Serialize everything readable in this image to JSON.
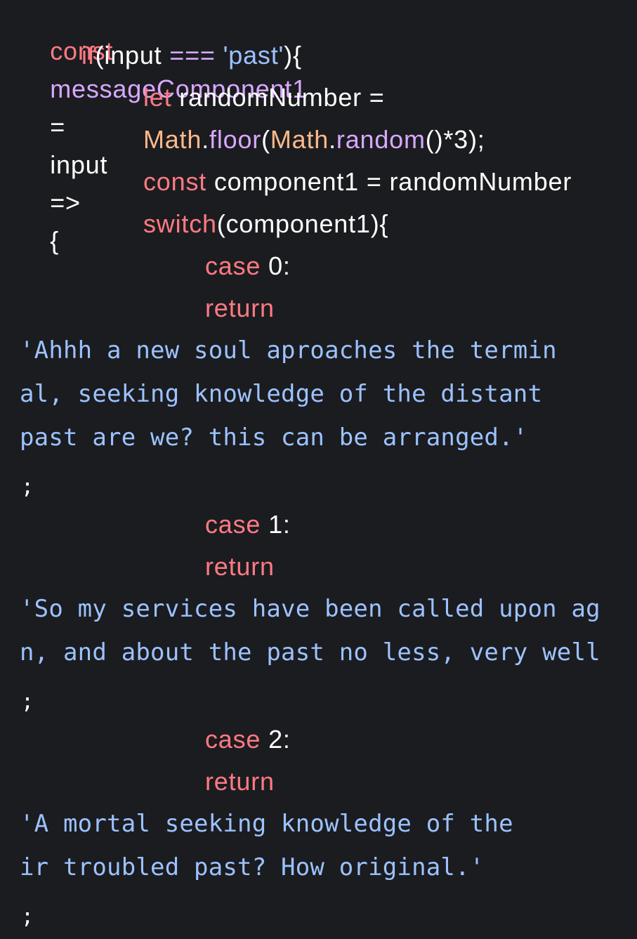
{
  "code": {
    "l1": {
      "t1": "const",
      "t2": "messageComponent1",
      "t3": "=",
      "t4": "input",
      "t5": "=>",
      "t6": "{"
    },
    "l2": {
      "t1": "if",
      "t2": "(input",
      "t3": "===",
      "t4": "'past'",
      "t5": "){"
    },
    "l3": {
      "t1": "let",
      "t2": "randomNumber",
      "t3": "="
    },
    "l4": {
      "t1": "Math",
      "t2": ".",
      "t3": "floor",
      "t4": "(",
      "t5": "Math",
      "t6": ".",
      "t7": "random",
      "t8": "()*3);"
    },
    "l5": {
      "t1": "const",
      "t2": "component1",
      "t3": "=",
      "t4": "randomNumber"
    },
    "l6": {
      "t1": "switch",
      "t2": "(component1){"
    },
    "l7": {
      "t1": "case",
      "t2": "0:"
    },
    "l8": {
      "t1": "return"
    },
    "l9": {
      "t1": "'Ahhh a new soul aproaches the termin"
    },
    "l10": {
      "t1": "al, seeking knowledge of the distant"
    },
    "l11": {
      "t1": "past are we? this can be arranged.'"
    },
    "l12": {
      "t1": ";"
    },
    "l13": {
      "t1": "case",
      "t2": "1:"
    },
    "l14": {
      "t1": "return"
    },
    "l15": {
      "t1": "'So my services have been called upon ag"
    },
    "l16": {
      "t1": "n, and about the past no less, very well"
    },
    "l17": {
      "t1": ";"
    },
    "l18": {
      "t1": "case",
      "t2": "2:"
    },
    "l19": {
      "t1": "return"
    },
    "l20": {
      "t1": "'A mortal seeking knowledge of the"
    },
    "l21": {
      "t1": "ir troubled past? How original.'"
    },
    "l22": {
      "t1": ";"
    }
  },
  "colors": {
    "background": "#1b1c20",
    "keyword": "#ff7a82",
    "identifier": "#ffffff",
    "function": "#d8a8ff",
    "string": "#9cc2ff",
    "class": "#ffb98a"
  }
}
